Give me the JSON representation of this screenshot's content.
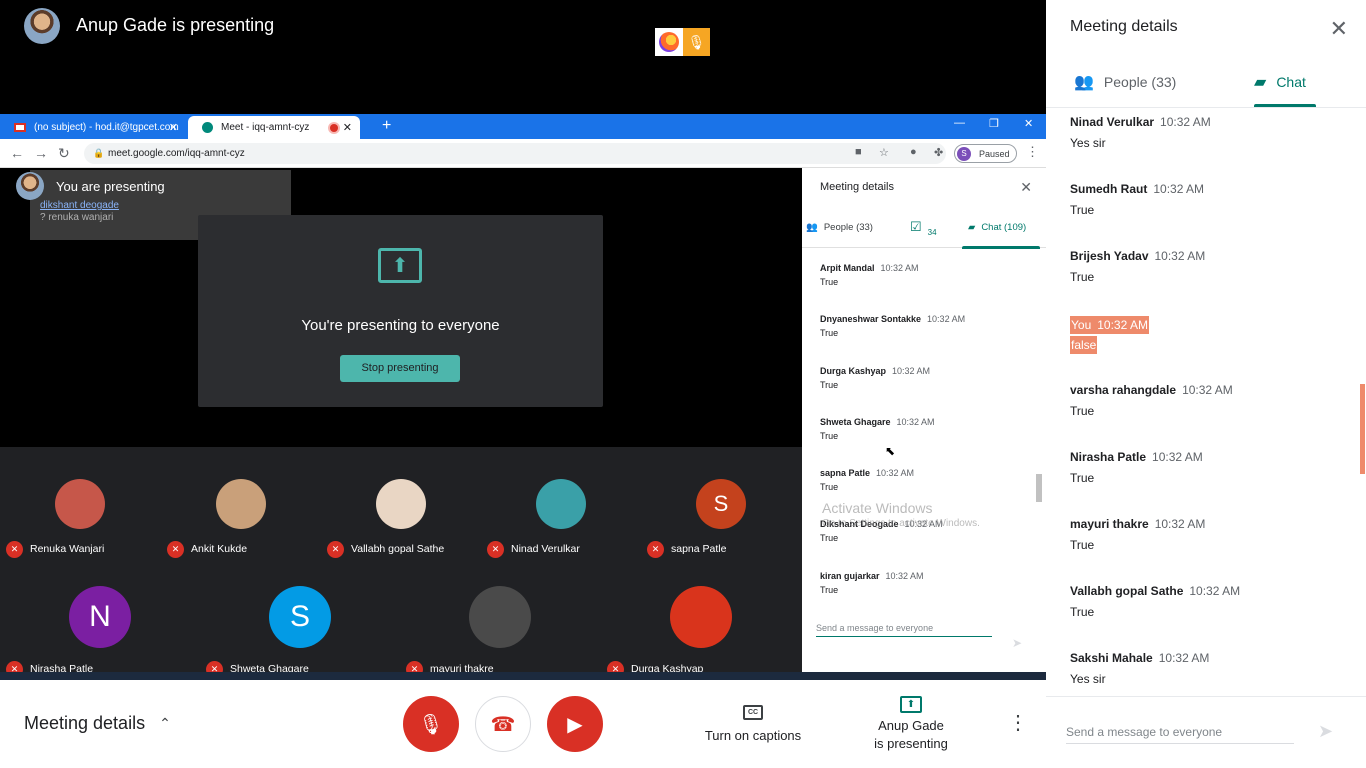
{
  "topbar": {
    "presenter_title": "Anup Gade is presenting"
  },
  "browser": {
    "tabs": [
      {
        "label": "(no subject) - hod.it@tgpcet.com"
      },
      {
        "label": "Meet - iqq-amnt-cyz"
      }
    ],
    "url": "meet.google.com/iqq-amnt-cyz",
    "profile_status": "Paused",
    "profile_initial": "S"
  },
  "stage": {
    "you_presenting": "You are presenting",
    "overlay_line1": "dikshant deogade",
    "overlay_line2": "? renuka wanjari",
    "present_text": "You're presenting to everyone",
    "stop_button": "Stop presenting"
  },
  "participants": [
    {
      "name": "Renuka Wanjari",
      "initial": "",
      "color": "#c6574a"
    },
    {
      "name": "Ankit Kukde",
      "initial": "",
      "color": "#c9a07a"
    },
    {
      "name": "Vallabh gopal Sathe",
      "initial": "",
      "color": "#e9d6c4"
    },
    {
      "name": "Ninad Verulkar",
      "initial": "",
      "color": "#3aa0a8"
    },
    {
      "name": "sapna Patle",
      "initial": "S",
      "color": "#c4421d"
    },
    {
      "name": "Nirasha Patle",
      "initial": "N",
      "color": "#7b1fa2"
    },
    {
      "name": "Shweta Ghagare",
      "initial": "S",
      "color": "#039be5"
    },
    {
      "name": "mayuri thakre",
      "initial": "",
      "color": "#4a4a4a"
    },
    {
      "name": "Durga Kashyap",
      "initial": "",
      "color": "#d9341c"
    }
  ],
  "inner_panel": {
    "title": "Meeting details",
    "people_tab": "People (33)",
    "tasks_count": "34",
    "chat_tab": "Chat (109)",
    "messages": [
      {
        "sender": "Arpit Mandal",
        "time": "10:32 AM",
        "text": "True"
      },
      {
        "sender": "Dnyaneshwar Sontakke",
        "time": "10:32 AM",
        "text": "True"
      },
      {
        "sender": "Durga Kashyap",
        "time": "10:32 AM",
        "text": "True"
      },
      {
        "sender": "Shweta Ghagare",
        "time": "10:32 AM",
        "text": "True"
      },
      {
        "sender": "sapna Patle",
        "time": "10:32 AM",
        "text": "True"
      },
      {
        "sender": "Dikshant Deogade",
        "time": "10:32 AM",
        "text": "True"
      },
      {
        "sender": "kiran gujarkar",
        "time": "10:32 AM",
        "text": "True"
      }
    ],
    "input_placeholder": "Send a message to everyone"
  },
  "activate": {
    "line1": "Activate Windows",
    "line2": "Go to Settings to activate Windows."
  },
  "bottombar": {
    "meeting_details": "Meeting details",
    "captions": "Turn on captions",
    "presenting_line1": "Anup Gade",
    "presenting_line2": "is presenting"
  },
  "side_panel": {
    "title": "Meeting details",
    "people_tab": "People (33)",
    "chat_tab": "Chat",
    "messages": [
      {
        "sender": "Ninad Verulkar",
        "time": "10:32 AM",
        "text": "Yes sir",
        "self": false
      },
      {
        "sender": "Sumedh Raut",
        "time": "10:32 AM",
        "text": "True",
        "self": false
      },
      {
        "sender": "Brijesh Yadav",
        "time": "10:32 AM",
        "text": "True",
        "self": false
      },
      {
        "sender": "You",
        "time": "10:32 AM",
        "text": "false",
        "self": true
      },
      {
        "sender": "varsha rahangdale",
        "time": "10:32 AM",
        "text": "True",
        "self": false
      },
      {
        "sender": "Nirasha Patle",
        "time": "10:32 AM",
        "text": "True",
        "self": false
      },
      {
        "sender": "mayuri thakre",
        "time": "10:32 AM",
        "text": "True",
        "self": false
      },
      {
        "sender": "Vallabh gopal Sathe",
        "time": "10:32 AM",
        "text": "True",
        "self": false
      },
      {
        "sender": "Sakshi Mahale",
        "time": "10:32 AM",
        "text": "Yes sir",
        "self": false
      }
    ],
    "input_placeholder": "Send a message to everyone"
  }
}
